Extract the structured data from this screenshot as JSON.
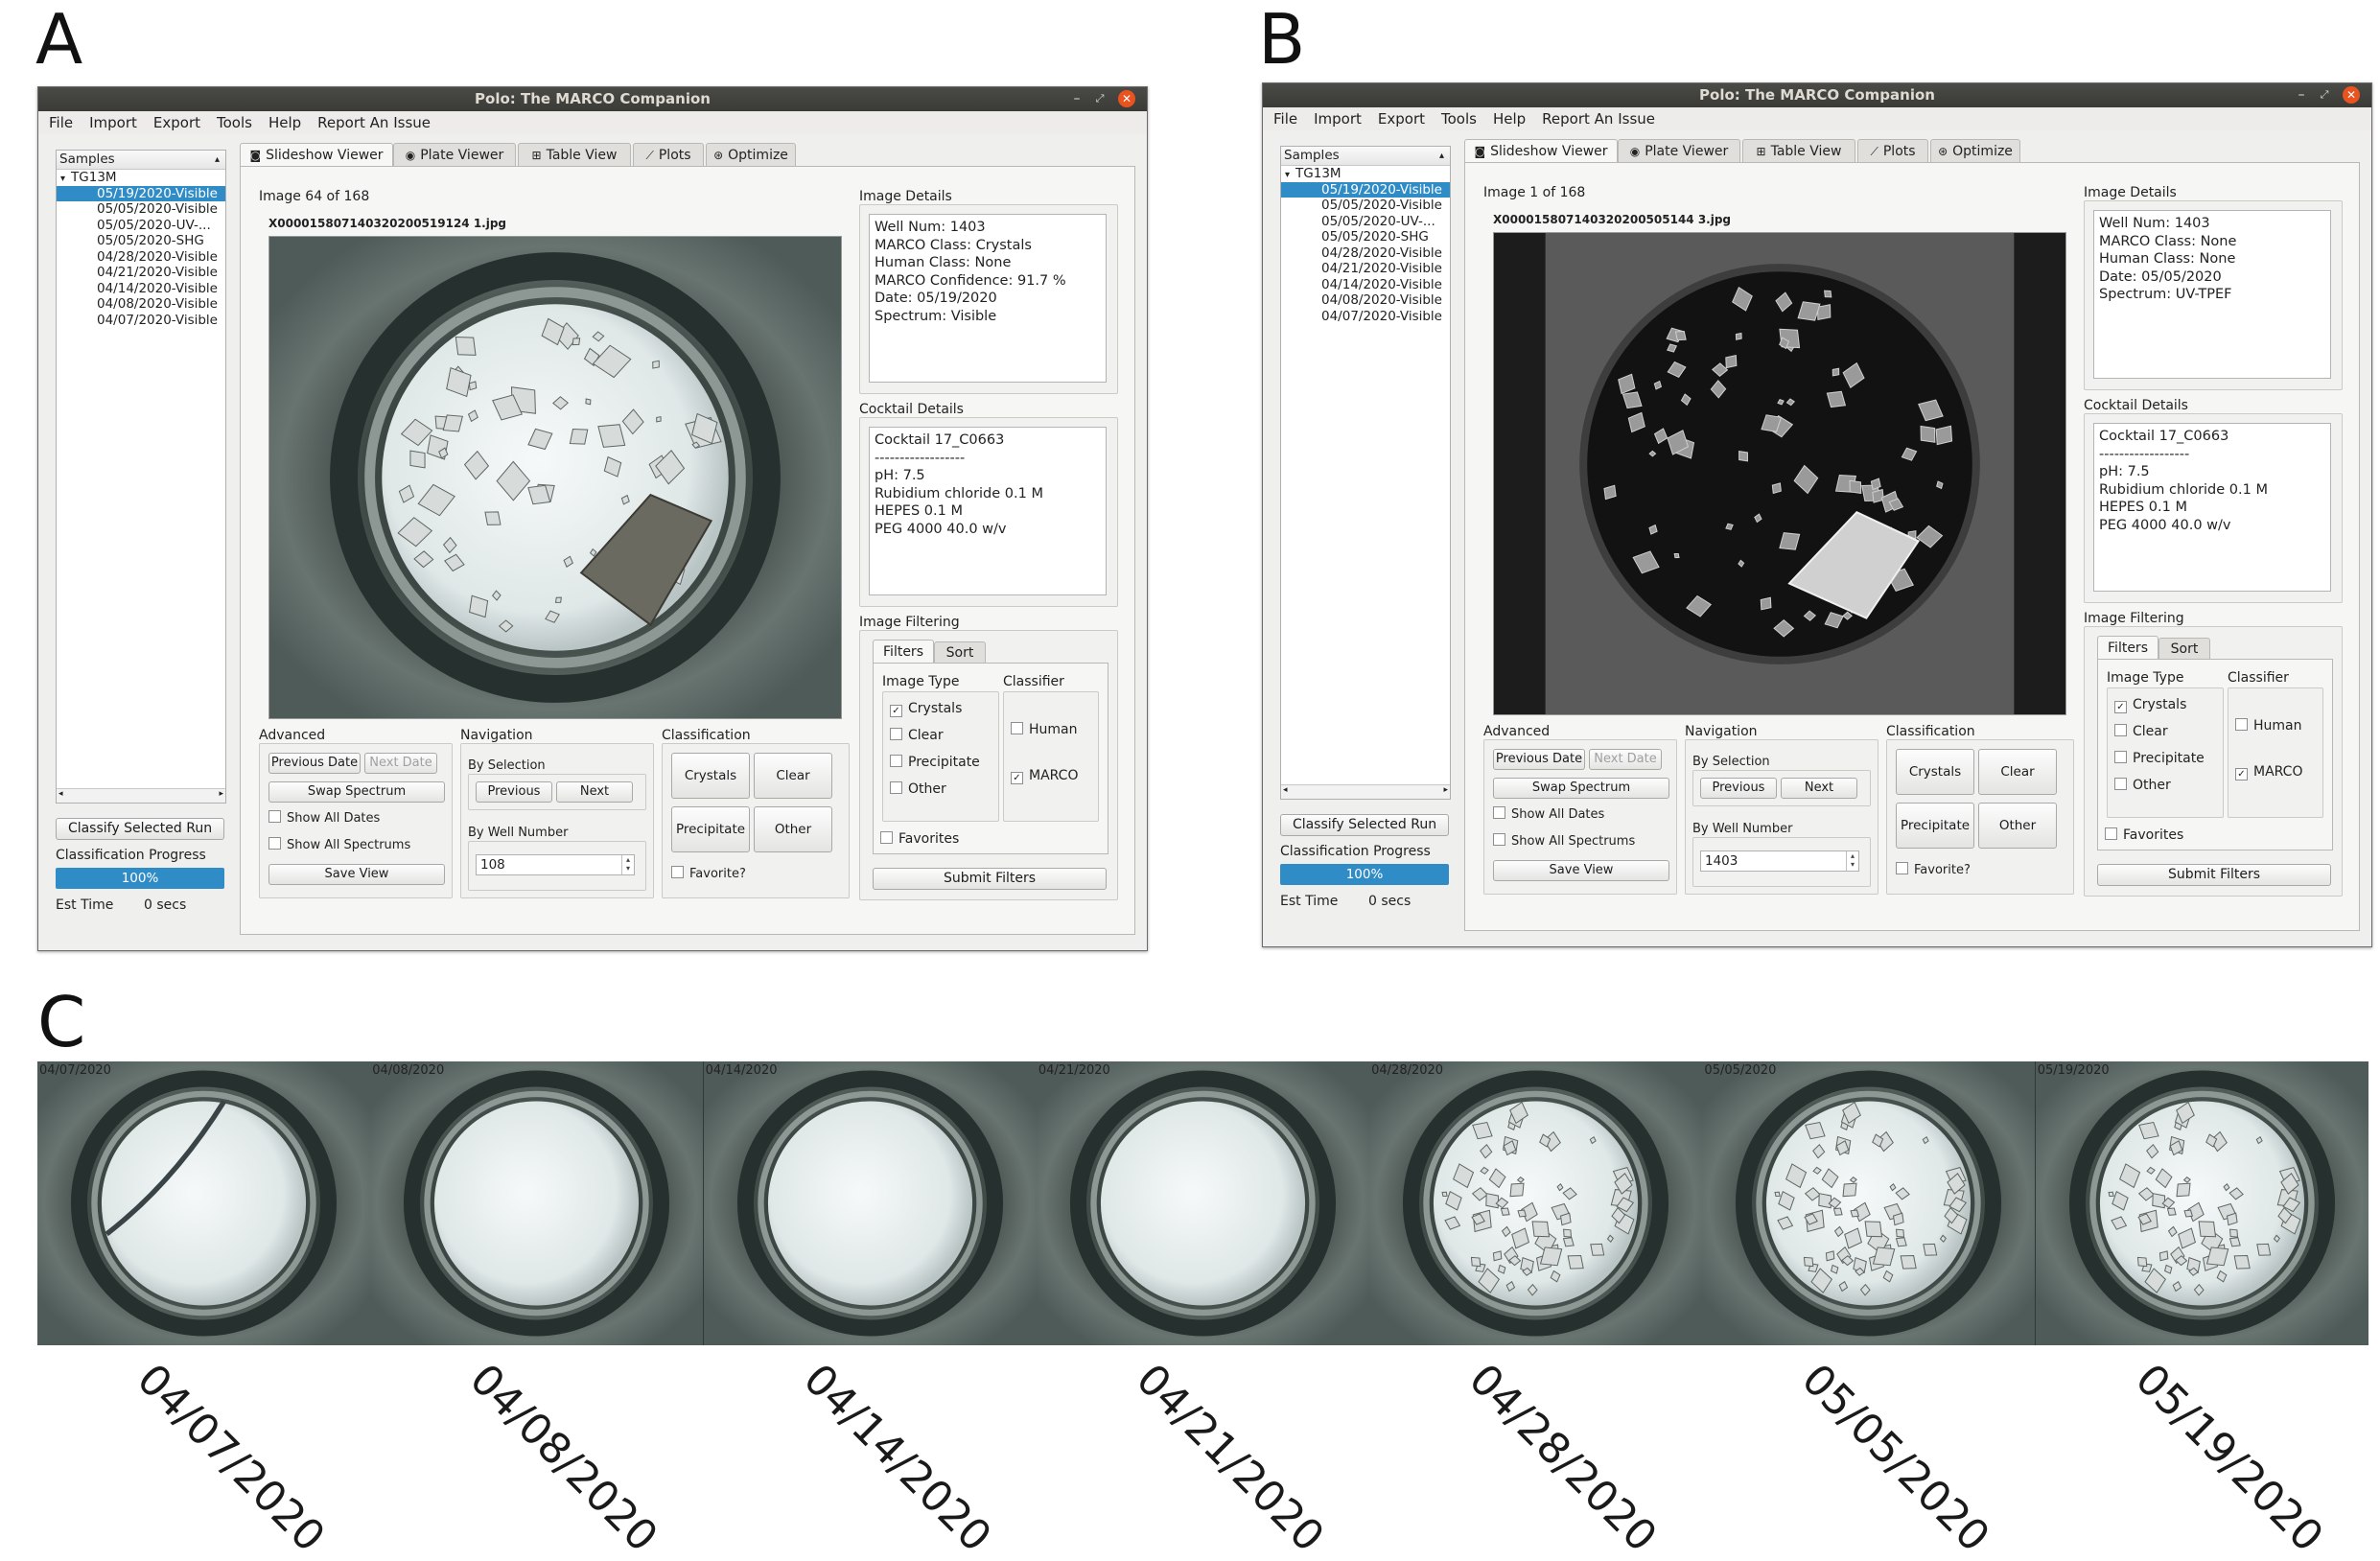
{
  "panel_labels": {
    "a": "A",
    "b": "B",
    "c": "C"
  },
  "app": {
    "title": "Polo: The MARCO Companion",
    "window_controls": {
      "minimize": "–",
      "maximize": "⤢",
      "close": "✕"
    },
    "menu": [
      "File",
      "Import",
      "Export",
      "Tools",
      "Help",
      "Report An Issue"
    ],
    "samples_header": "Samples",
    "run_name": "TG13M",
    "tabs": [
      "Slideshow Viewer",
      "Plate Viewer",
      "Table View",
      "Plots",
      "Optimize"
    ],
    "classify_button": "Classify Selected Run",
    "progress_label": "Classification Progress",
    "progress_value": "100%",
    "est_time_label": "Est Time",
    "est_time_value": "0 secs",
    "image_details_label": "Image Details",
    "cocktail_details_label": "Cocktail Details",
    "cocktail_text": "Cocktail 17_C0663\n------------------\npH: 7.5\nRubidium chloride 0.1 M\nHEPES 0.1 M\nPEG 4000 40.0 w/v",
    "image_filtering_label": "Image Filtering",
    "filter_tabs": [
      "Filters",
      "Sort"
    ],
    "image_type_label": "Image Type",
    "image_types": [
      "Crystals",
      "Clear",
      "Precipitate",
      "Other"
    ],
    "classifier_label": "Classifier",
    "classifiers": [
      "Human",
      "MARCO"
    ],
    "favorites_label": "Favorites",
    "submit_filters": "Submit Filters",
    "advanced_label": "Advanced",
    "previous_date": "Previous Date",
    "next_date": "Next Date",
    "swap_spectrum": "Swap Spectrum",
    "show_all_dates": "Show All Dates",
    "show_all_spectrums": "Show All Spectrums",
    "save_view": "Save View",
    "navigation_label": "Navigation",
    "by_selection": "By Selection",
    "previous": "Previous",
    "next": "Next",
    "by_well_number": "By Well Number",
    "classification_label": "Classification",
    "class_buttons": [
      "Crystals",
      "Clear",
      "Precipitate",
      "Other"
    ],
    "favorite_checkbox": "Favorite?",
    "check_mark": "✓",
    "spin_up": "▴",
    "spin_down": "▾",
    "scroll_left": "◂",
    "scroll_right": "▸",
    "collapse_arrow": "▾",
    "sort_arrow": "▴"
  },
  "window_a": {
    "samples": [
      "05/19/2020-Visible",
      "05/05/2020-Visible",
      "05/05/2020-UV-...",
      "05/05/2020-SHG",
      "04/28/2020-Visible",
      "04/21/2020-Visible",
      "04/14/2020-Visible",
      "04/08/2020-Visible",
      "04/07/2020-Visible"
    ],
    "selected_index": 0,
    "image_counter": "Image 64 of 168",
    "filename": "X000015807140320200519124 1.jpg",
    "image_details": "Well Num: 1403\nMARCO Class: Crystals\nHuman Class: None\nMARCO Confidence: 91.7 %\nDate: 05/19/2020\nSpectrum: Visible",
    "well_number": "108",
    "checked_types": [
      "Crystals"
    ],
    "checked_classifiers": [
      "MARCO"
    ]
  },
  "window_b": {
    "samples": [
      "05/19/2020-Visible",
      "05/05/2020-Visible",
      "05/05/2020-UV-...",
      "05/05/2020-SHG",
      "04/28/2020-Visible",
      "04/21/2020-Visible",
      "04/14/2020-Visible",
      "04/08/2020-Visible",
      "04/07/2020-Visible"
    ],
    "selected_index": 0,
    "image_counter": "Image 1 of 168",
    "filename": "X000015807140320200505144 3.jpg",
    "image_details": "Well Num: 1403\nMARCO Class: None\nHuman Class: None\nDate: 05/05/2020\nSpectrum: UV-TPEF",
    "well_number": "1403",
    "checked_types": [
      "Crystals"
    ],
    "checked_classifiers": [
      "MARCO"
    ]
  },
  "timeline": {
    "dates": [
      "04/07/2020",
      "04/08/2020",
      "04/14/2020",
      "04/21/2020",
      "04/28/2020",
      "05/05/2020",
      "05/19/2020"
    ],
    "crystal_density": [
      0,
      0,
      0,
      0,
      0.85,
      0.9,
      0.9
    ]
  }
}
